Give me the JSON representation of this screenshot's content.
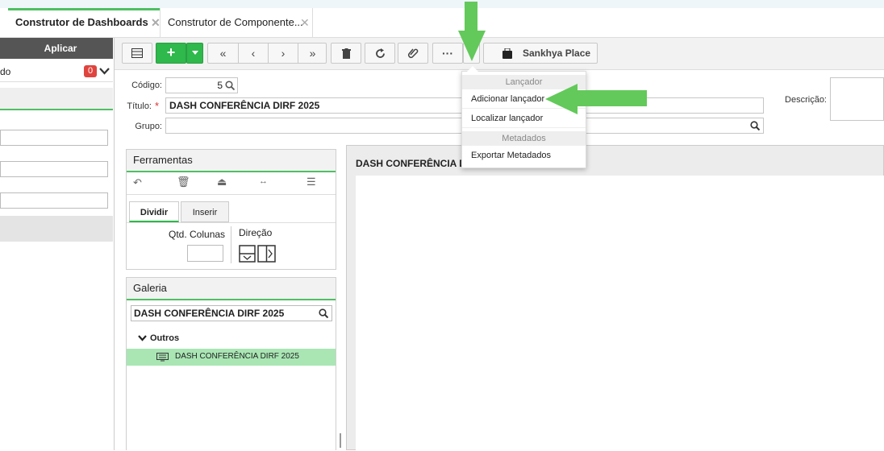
{
  "tabs": [
    {
      "label": "Construtor de Dashboards",
      "close": "✕"
    },
    {
      "label": "Construtor de Componente...",
      "close": "✕"
    }
  ],
  "left": {
    "aplicar": "Aplicar",
    "row_label": "do",
    "badge": "0"
  },
  "toolbar": {
    "add": "+",
    "more": "···",
    "place": "Sankhya Place"
  },
  "form": {
    "codigo_label": "Código:",
    "codigo_value": "5",
    "titulo_label": "Título:",
    "required": "*",
    "titulo_value": "DASH CONFERÊNCIA DIRF 2025",
    "grupo_label": "Grupo:",
    "grupo_value": "",
    "descricao_label": "Descrição:"
  },
  "ferramentas": {
    "title": "Ferramentas",
    "tab_dividir": "Dividir",
    "tab_inserir": "Inserir",
    "qtd_label": "Qtd. Colunas",
    "direcao_label": "Direção"
  },
  "galeria": {
    "title": "Galeria",
    "search_value": "DASH CONFERÊNCIA DIRF 2025",
    "group": "Outros",
    "item": "DASH CONFERÊNCIA DIRF 2025"
  },
  "canvas": {
    "title": "DASH CONFERÊNCIA D"
  },
  "dropdown": {
    "section1": "Lançador",
    "item_add": "Adicionar lançador",
    "item_find": "Localizar lançador",
    "section2": "Metadados",
    "item_export": "Exportar Metadados"
  },
  "colors": {
    "accent": "#2fb84b",
    "arrow": "#63c95a",
    "badge": "#e0443e",
    "highlight": "#a9e6b4"
  }
}
